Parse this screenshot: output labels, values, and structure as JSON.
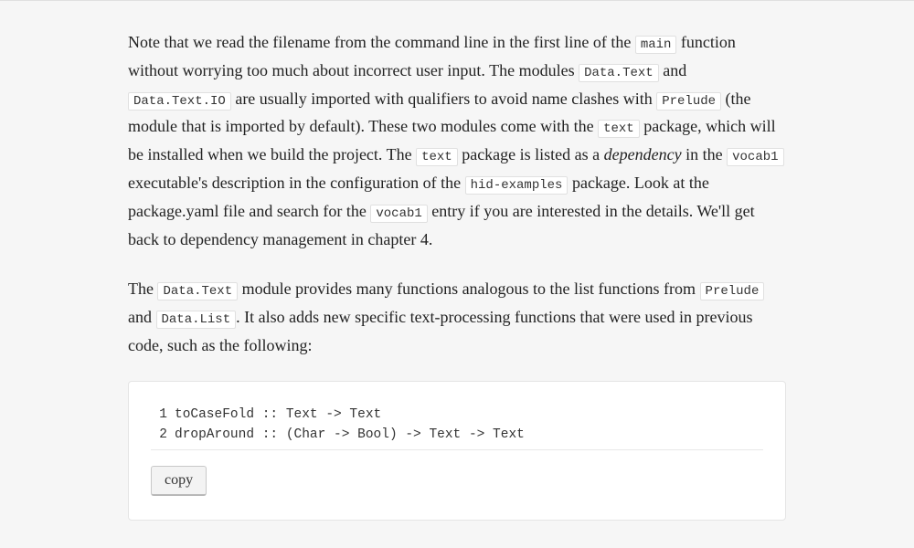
{
  "paragraphs": {
    "p1": {
      "t1": "Note that we read the filename from the command line in the first line of the ",
      "c1": "main",
      "t2": " function without worrying too much about incorrect user input. The modules ",
      "c2": "Data.Text",
      "t3": " and ",
      "c3": "Data.Text.IO",
      "t4": " are usually imported with qualifiers to avoid name clashes with ",
      "c4": "Prelude",
      "t5": " (the module that is imported by default). These two modules come with the ",
      "c5": "text",
      "t6": " package, which will be installed when we build the project. The ",
      "c6": "text",
      "t7": " package is listed as a ",
      "em1": "dependency",
      "t8": " in the ",
      "c7": "vocab1",
      "t9": " executable's description in the configuration of the ",
      "c8": "hid-examples",
      "t10": " package. Look at the package.yaml file and search for the ",
      "c9": "vocab1",
      "t11": " entry if you are interested in the details. We'll get back to dependency management in chapter 4."
    },
    "p2": {
      "t1": "The ",
      "c1": "Data.Text",
      "t2": " module provides many functions analogous to the list functions from ",
      "c2": "Prelude",
      "t3": " and ",
      "c3": "Data.List",
      "t4": ". It also adds new specific text-processing functions that were used in previous code, such as the following:"
    }
  },
  "code": {
    "lines": [
      {
        "num": "1",
        "text": "toCaseFold :: Text -> Text"
      },
      {
        "num": "2",
        "text": "dropAround :: (Char -> Bool) -> Text -> Text"
      }
    ],
    "copy_label": "copy"
  }
}
